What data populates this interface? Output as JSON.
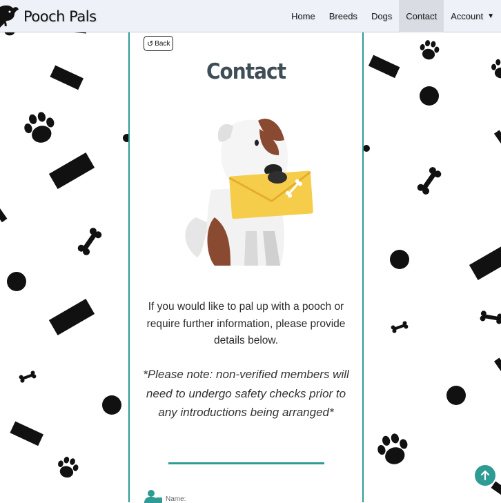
{
  "brand": {
    "name": "Pooch Pals"
  },
  "nav": {
    "items": [
      {
        "label": "Home"
      },
      {
        "label": "Breeds"
      },
      {
        "label": "Dogs"
      },
      {
        "label": "Contact",
        "active": true
      },
      {
        "label": "Account",
        "dropdown": true
      }
    ]
  },
  "page": {
    "back_label": "Back",
    "title": "Contact",
    "intro": "If you would like to pal up with a pooch or require further information, please provide details below.",
    "note": "*Please note: non-verified members will need to undergo safety checks prior to any introductions being arranged*",
    "form": {
      "name_label": "Name:"
    }
  },
  "icons": {
    "back": "undo-arrow-icon",
    "user": "user-icon",
    "scroll_top": "arrow-up-icon",
    "dropdown": "caret-down-icon"
  },
  "colors": {
    "accent": "#2e9b94",
    "nav_bg": "#eef1f8",
    "nav_active": "#d9dce3",
    "title": "#3f4d57"
  }
}
